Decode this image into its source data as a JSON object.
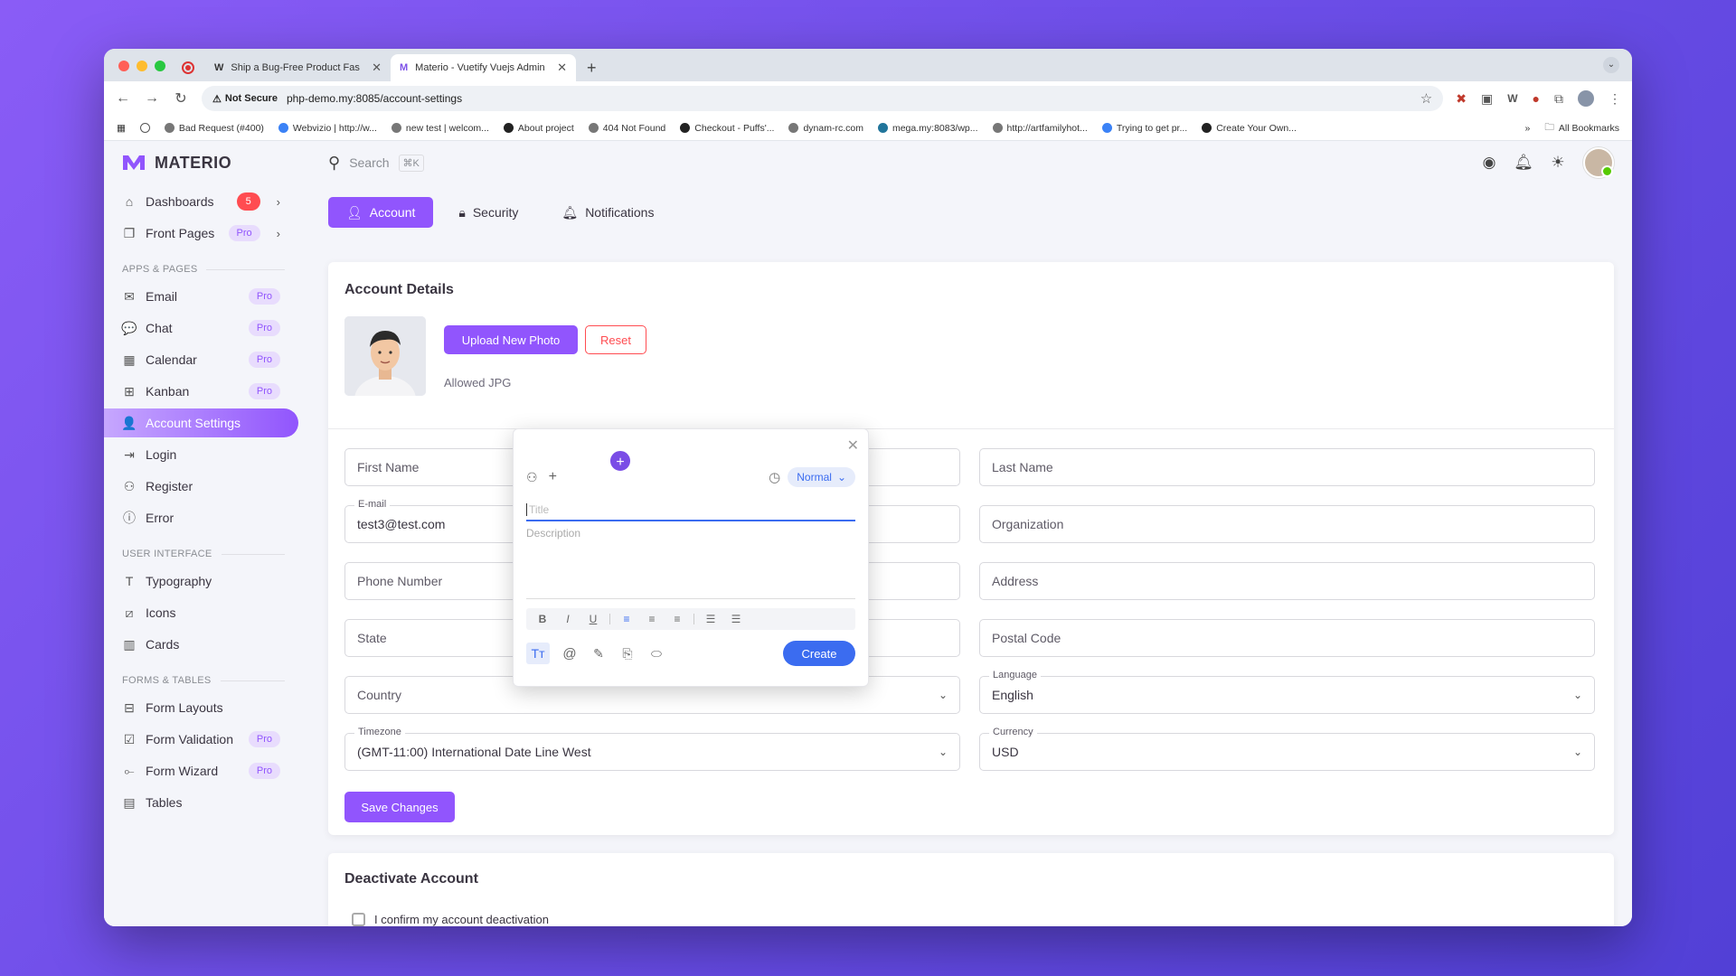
{
  "browser": {
    "tabs": [
      {
        "title": "Ship a Bug-Free Product Fas",
        "favicon": "W",
        "active": false
      },
      {
        "title": "Materio - Vuetify Vuejs Admin",
        "favicon": "M",
        "active": true
      }
    ],
    "security_label": "Not Secure",
    "url": "php-demo.my:8085/account-settings",
    "bookmarks": [
      "Bad Request (#400)",
      "Webvizio | http://w...",
      "new test | welcom...",
      "About project",
      "404 Not Found",
      "Checkout - Puffs'...",
      "dynam-rc.com",
      "mega.my:8083/wp...",
      "http://artfamilyhot...",
      "Trying to get pr...",
      "Create Your Own..."
    ],
    "all_bookmarks": "All Bookmarks"
  },
  "sidebar": {
    "brand": "MATERIO",
    "top_items": [
      {
        "label": "Dashboards",
        "badge": "5"
      },
      {
        "label": "Front Pages",
        "pill": "Pro"
      }
    ],
    "sections": [
      {
        "title": "APPS & PAGES",
        "items": [
          {
            "label": "Email",
            "pill": "Pro"
          },
          {
            "label": "Chat",
            "pill": "Pro"
          },
          {
            "label": "Calendar",
            "pill": "Pro"
          },
          {
            "label": "Kanban",
            "pill": "Pro"
          },
          {
            "label": "Account Settings",
            "active": true
          },
          {
            "label": "Login"
          },
          {
            "label": "Register"
          },
          {
            "label": "Error"
          }
        ]
      },
      {
        "title": "USER INTERFACE",
        "items": [
          {
            "label": "Typography"
          },
          {
            "label": "Icons"
          },
          {
            "label": "Cards"
          }
        ]
      },
      {
        "title": "FORMS & TABLES",
        "items": [
          {
            "label": "Form Layouts"
          },
          {
            "label": "Form Validation",
            "pill": "Pro"
          },
          {
            "label": "Form Wizard",
            "pill": "Pro"
          },
          {
            "label": "Tables"
          }
        ]
      }
    ]
  },
  "topbar": {
    "search_placeholder": "Search",
    "shortcut": "⌘K"
  },
  "account_tabs": [
    "Account",
    "Security",
    "Notifications"
  ],
  "account_details": {
    "title": "Account Details",
    "upload_label": "Upload New Photo",
    "reset_label": "Reset",
    "allowed_text": "Allowed JPG",
    "fields": {
      "first_name": "First Name",
      "last_name": "Last Name",
      "email_label": "E-mail",
      "email_value": "test3@test.com",
      "organization": "Organization",
      "phone": "Phone Number",
      "address": "Address",
      "state": "State",
      "postal": "Postal Code",
      "country": "Country",
      "language_label": "Language",
      "language_value": "English",
      "timezone_label": "Timezone",
      "timezone_value": "(GMT-11:00) International Date Line West",
      "currency_label": "Currency",
      "currency_value": "USD"
    },
    "save_label": "Save Changes"
  },
  "deactivate": {
    "title": "Deactivate Account",
    "confirm_label": "I confirm my account deactivation"
  },
  "popup": {
    "priority": "Normal",
    "title_placeholder": "Title",
    "description_placeholder": "Description",
    "create_label": "Create"
  },
  "colors": {
    "primary": "#9155fd",
    "danger": "#ff4c51",
    "create_button": "#3b6cf0"
  }
}
